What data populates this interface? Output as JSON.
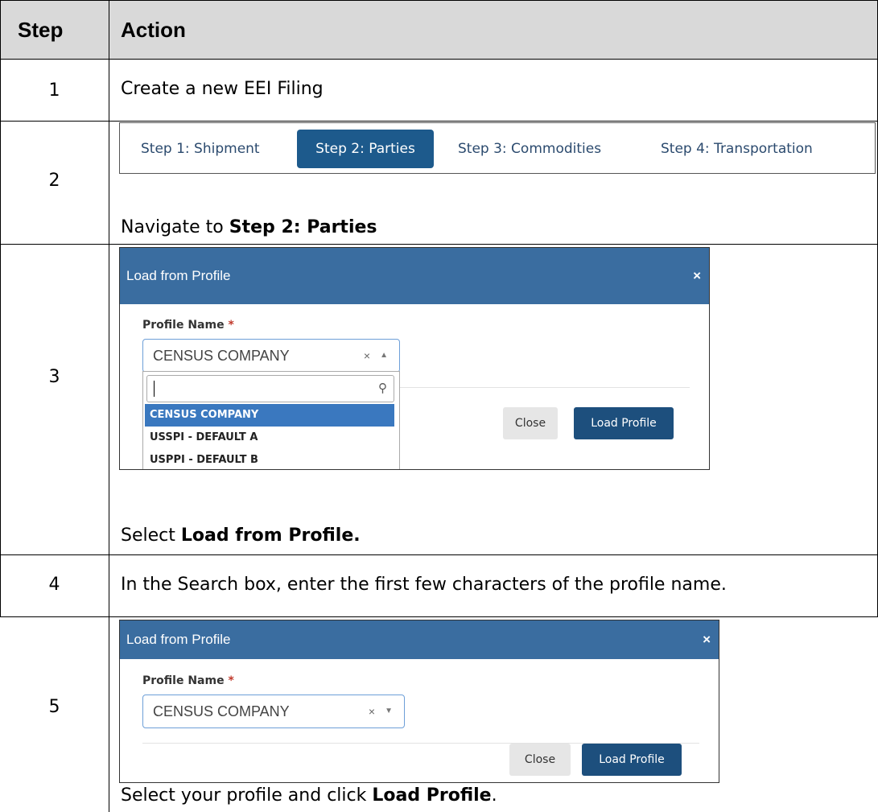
{
  "table": {
    "headers": {
      "step": "Step",
      "action": "Action"
    },
    "rows": [
      {
        "step": "1",
        "action": "Create a new EEI Filing"
      },
      {
        "step": "2",
        "action_prefix": "Navigate to ",
        "action_bold": "Step 2: Parties",
        "action_suffix": ""
      },
      {
        "step": "3",
        "action_prefix": "Select ",
        "action_bold": "Load from Profile.",
        "action_suffix": ""
      },
      {
        "step": "4",
        "action": "In the Search box, enter the first few characters of the profile name."
      },
      {
        "step": "5",
        "action_prefix": "Select your profile and click ",
        "action_bold": "Load Profile",
        "action_suffix": "."
      }
    ]
  },
  "step_tabs": {
    "tabs": [
      "Step 1: Shipment",
      "Step 2: Parties",
      "Step 3: Commodities",
      "Step 4: Transportation"
    ],
    "active_index": 1
  },
  "modal_expanded": {
    "title": "Load from Profile",
    "close_glyph": "×",
    "field_label": "Profile Name",
    "required_mark": "*",
    "selected_value": "CENSUS COMPANY",
    "clear_glyph": "×",
    "arrow_glyph": "▲",
    "search_value": "",
    "search_icon": "magnifier-icon",
    "options": [
      "CENSUS COMPANY",
      "USSPI - DEFAULT A",
      "USPPI - DEFAULT B"
    ],
    "selected_option_index": 0,
    "close_button": "Close",
    "load_button": "Load Profile"
  },
  "modal_collapsed": {
    "title": "Load from Profile",
    "close_glyph": "×",
    "field_label": "Profile Name",
    "required_mark": "*",
    "selected_value": "CENSUS COMPANY",
    "clear_glyph": "×",
    "arrow_glyph": "▼",
    "close_button": "Close",
    "load_button": "Load Profile"
  }
}
